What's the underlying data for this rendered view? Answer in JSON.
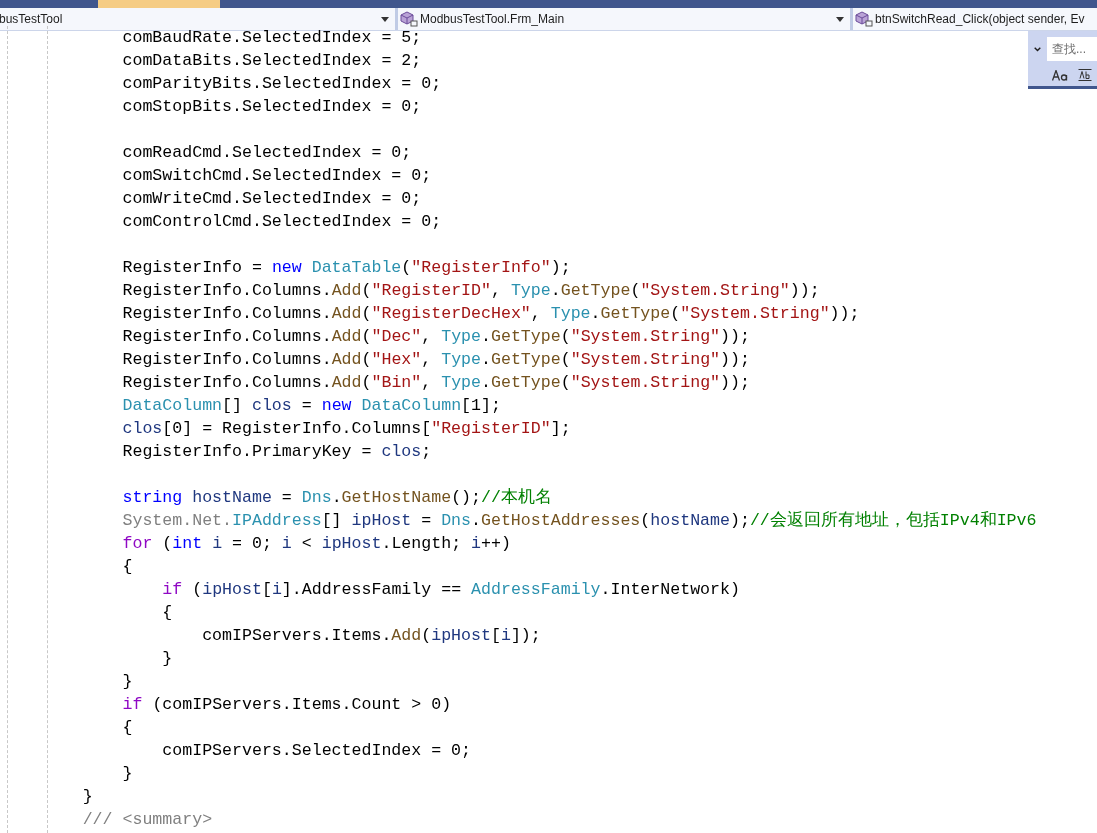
{
  "nav_bar": {
    "project": "busTestTool",
    "class": "ModbusTestTool.Frm_Main",
    "member": "btnSwitchRead_Click(object sender, Ev"
  },
  "find_widget": {
    "placeholder": "查找..."
  },
  "code_lines": [
    {
      "kind": "code",
      "tokens": [
        {
          "kind": "plain",
          "text": "            comBaudRate.SelectedIndex = 5;"
        }
      ]
    },
    {
      "kind": "code",
      "tokens": [
        {
          "kind": "plain",
          "text": "            comDataBits.SelectedIndex = 2;"
        }
      ]
    },
    {
      "kind": "code",
      "tokens": [
        {
          "kind": "plain",
          "text": "            comParityBits.SelectedIndex = 0;"
        }
      ]
    },
    {
      "kind": "code",
      "tokens": [
        {
          "kind": "plain",
          "text": "            comStopBits.SelectedIndex = 0;"
        }
      ]
    },
    {
      "kind": "blank"
    },
    {
      "kind": "code",
      "tokens": [
        {
          "kind": "plain",
          "text": "            comReadCmd.SelectedIndex = 0;"
        }
      ]
    },
    {
      "kind": "code",
      "tokens": [
        {
          "kind": "plain",
          "text": "            comSwitchCmd.SelectedIndex = 0;"
        }
      ]
    },
    {
      "kind": "code",
      "tokens": [
        {
          "kind": "plain",
          "text": "            comWriteCmd.SelectedIndex = 0;"
        }
      ]
    },
    {
      "kind": "code",
      "tokens": [
        {
          "kind": "plain",
          "text": "            comControlCmd.SelectedIndex = 0;"
        }
      ]
    },
    {
      "kind": "blank"
    },
    {
      "kind": "code",
      "tokens": [
        {
          "kind": "plain",
          "text": "            RegisterInfo = "
        },
        {
          "kind": "keyword",
          "text": "new"
        },
        {
          "kind": "type",
          "text": " DataTable"
        },
        {
          "kind": "plain",
          "text": "("
        },
        {
          "kind": "string",
          "text": "\"RegisterInfo\""
        },
        {
          "kind": "plain",
          "text": ");"
        }
      ]
    },
    {
      "kind": "code",
      "tokens": [
        {
          "kind": "plain",
          "text": "            RegisterInfo.Columns."
        },
        {
          "kind": "method",
          "text": "Add"
        },
        {
          "kind": "plain",
          "text": "("
        },
        {
          "kind": "string",
          "text": "\"RegisterID\""
        },
        {
          "kind": "plain",
          "text": ", "
        },
        {
          "kind": "type",
          "text": "Type"
        },
        {
          "kind": "plain",
          "text": "."
        },
        {
          "kind": "method",
          "text": "GetType"
        },
        {
          "kind": "plain",
          "text": "("
        },
        {
          "kind": "string",
          "text": "\"System.String\""
        },
        {
          "kind": "plain",
          "text": "));"
        }
      ]
    },
    {
      "kind": "code",
      "tokens": [
        {
          "kind": "plain",
          "text": "            RegisterInfo.Columns."
        },
        {
          "kind": "method",
          "text": "Add"
        },
        {
          "kind": "plain",
          "text": "("
        },
        {
          "kind": "string",
          "text": "\"RegisterDecHex\""
        },
        {
          "kind": "plain",
          "text": ", "
        },
        {
          "kind": "type",
          "text": "Type"
        },
        {
          "kind": "plain",
          "text": "."
        },
        {
          "kind": "method",
          "text": "GetType"
        },
        {
          "kind": "plain",
          "text": "("
        },
        {
          "kind": "string",
          "text": "\"System.String\""
        },
        {
          "kind": "plain",
          "text": "));"
        }
      ]
    },
    {
      "kind": "code",
      "tokens": [
        {
          "kind": "plain",
          "text": "            RegisterInfo.Columns."
        },
        {
          "kind": "method",
          "text": "Add"
        },
        {
          "kind": "plain",
          "text": "("
        },
        {
          "kind": "string",
          "text": "\"Dec\""
        },
        {
          "kind": "plain",
          "text": ", "
        },
        {
          "kind": "type",
          "text": "Type"
        },
        {
          "kind": "plain",
          "text": "."
        },
        {
          "kind": "method",
          "text": "GetType"
        },
        {
          "kind": "plain",
          "text": "("
        },
        {
          "kind": "string",
          "text": "\"System.String\""
        },
        {
          "kind": "plain",
          "text": "));"
        }
      ]
    },
    {
      "kind": "code",
      "tokens": [
        {
          "kind": "plain",
          "text": "            RegisterInfo.Columns."
        },
        {
          "kind": "method",
          "text": "Add"
        },
        {
          "kind": "plain",
          "text": "("
        },
        {
          "kind": "string",
          "text": "\"Hex\""
        },
        {
          "kind": "plain",
          "text": ", "
        },
        {
          "kind": "type",
          "text": "Type"
        },
        {
          "kind": "plain",
          "text": "."
        },
        {
          "kind": "method",
          "text": "GetType"
        },
        {
          "kind": "plain",
          "text": "("
        },
        {
          "kind": "string",
          "text": "\"System.String\""
        },
        {
          "kind": "plain",
          "text": "));"
        }
      ]
    },
    {
      "kind": "code",
      "tokens": [
        {
          "kind": "plain",
          "text": "            RegisterInfo.Columns."
        },
        {
          "kind": "method",
          "text": "Add"
        },
        {
          "kind": "plain",
          "text": "("
        },
        {
          "kind": "string",
          "text": "\"Bin\""
        },
        {
          "kind": "plain",
          "text": ", "
        },
        {
          "kind": "type",
          "text": "Type"
        },
        {
          "kind": "plain",
          "text": "."
        },
        {
          "kind": "method",
          "text": "GetType"
        },
        {
          "kind": "plain",
          "text": "("
        },
        {
          "kind": "string",
          "text": "\"System.String\""
        },
        {
          "kind": "plain",
          "text": "));"
        }
      ]
    },
    {
      "kind": "code",
      "tokens": [
        {
          "kind": "type",
          "text": "            DataColumn"
        },
        {
          "kind": "plain",
          "text": "[] "
        },
        {
          "kind": "local",
          "text": "clos"
        },
        {
          "kind": "plain",
          "text": " = "
        },
        {
          "kind": "keyword",
          "text": "new"
        },
        {
          "kind": "type",
          "text": " DataColumn"
        },
        {
          "kind": "plain",
          "text": "[1];"
        }
      ]
    },
    {
      "kind": "code",
      "tokens": [
        {
          "kind": "local",
          "text": "            clos"
        },
        {
          "kind": "plain",
          "text": "[0] = RegisterInfo.Columns["
        },
        {
          "kind": "string",
          "text": "\"RegisterID\""
        },
        {
          "kind": "plain",
          "text": "];"
        }
      ]
    },
    {
      "kind": "code",
      "tokens": [
        {
          "kind": "plain",
          "text": "            RegisterInfo.PrimaryKey = "
        },
        {
          "kind": "local",
          "text": "clos"
        },
        {
          "kind": "plain",
          "text": ";"
        }
      ]
    },
    {
      "kind": "blank"
    },
    {
      "kind": "code",
      "tokens": [
        {
          "kind": "keyword",
          "text": "            string"
        },
        {
          "kind": "local",
          "text": " hostName"
        },
        {
          "kind": "plain",
          "text": " = "
        },
        {
          "kind": "type",
          "text": "Dns"
        },
        {
          "kind": "plain",
          "text": "."
        },
        {
          "kind": "method",
          "text": "GetHostName"
        },
        {
          "kind": "plain",
          "text": "();"
        },
        {
          "kind": "comment",
          "text": "//本机名"
        }
      ]
    },
    {
      "kind": "code",
      "tokens": [
        {
          "kind": "dim",
          "text": "            System.Net."
        },
        {
          "kind": "type",
          "text": "IPAddress"
        },
        {
          "kind": "plain",
          "text": "[] "
        },
        {
          "kind": "local",
          "text": "ipHost"
        },
        {
          "kind": "plain",
          "text": " = "
        },
        {
          "kind": "type",
          "text": "Dns"
        },
        {
          "kind": "plain",
          "text": "."
        },
        {
          "kind": "method",
          "text": "GetHostAddresses"
        },
        {
          "kind": "plain",
          "text": "("
        },
        {
          "kind": "local",
          "text": "hostName"
        },
        {
          "kind": "plain",
          "text": ");"
        },
        {
          "kind": "comment",
          "text": "//会返回所有地址，包括IPv4和IPv6"
        }
      ]
    },
    {
      "kind": "code",
      "tokens": [
        {
          "kind": "control",
          "text": "            for"
        },
        {
          "kind": "plain",
          "text": " ("
        },
        {
          "kind": "keyword",
          "text": "int"
        },
        {
          "kind": "local",
          "text": " i"
        },
        {
          "kind": "plain",
          "text": " = 0; "
        },
        {
          "kind": "local",
          "text": "i"
        },
        {
          "kind": "plain",
          "text": " < "
        },
        {
          "kind": "local",
          "text": "ipHost"
        },
        {
          "kind": "plain",
          "text": ".Length; "
        },
        {
          "kind": "local",
          "text": "i"
        },
        {
          "kind": "plain",
          "text": "++)"
        }
      ]
    },
    {
      "kind": "code",
      "tokens": [
        {
          "kind": "plain",
          "text": "            {"
        }
      ]
    },
    {
      "kind": "code",
      "tokens": [
        {
          "kind": "control",
          "text": "                if"
        },
        {
          "kind": "plain",
          "text": " ("
        },
        {
          "kind": "local",
          "text": "ipHost"
        },
        {
          "kind": "plain",
          "text": "["
        },
        {
          "kind": "local",
          "text": "i"
        },
        {
          "kind": "plain",
          "text": "].AddressFamily == "
        },
        {
          "kind": "type",
          "text": "AddressFamily"
        },
        {
          "kind": "plain",
          "text": ".InterNetwork)"
        }
      ]
    },
    {
      "kind": "code",
      "tokens": [
        {
          "kind": "plain",
          "text": "                {"
        }
      ]
    },
    {
      "kind": "code",
      "tokens": [
        {
          "kind": "plain",
          "text": "                    comIPServers.Items."
        },
        {
          "kind": "method",
          "text": "Add"
        },
        {
          "kind": "plain",
          "text": "("
        },
        {
          "kind": "local",
          "text": "ipHost"
        },
        {
          "kind": "plain",
          "text": "["
        },
        {
          "kind": "local",
          "text": "i"
        },
        {
          "kind": "plain",
          "text": "]);"
        }
      ]
    },
    {
      "kind": "code",
      "tokens": [
        {
          "kind": "plain",
          "text": "                }"
        }
      ]
    },
    {
      "kind": "code",
      "tokens": [
        {
          "kind": "plain",
          "text": "            }"
        }
      ]
    },
    {
      "kind": "code",
      "tokens": [
        {
          "kind": "control",
          "text": "            if"
        },
        {
          "kind": "plain",
          "text": " (comIPServers.Items.Count > 0)"
        }
      ]
    },
    {
      "kind": "code",
      "tokens": [
        {
          "kind": "plain",
          "text": "            {"
        }
      ]
    },
    {
      "kind": "code",
      "tokens": [
        {
          "kind": "plain",
          "text": "                comIPServers.SelectedIndex = 0;"
        }
      ]
    },
    {
      "kind": "code",
      "tokens": [
        {
          "kind": "plain",
          "text": "            }"
        }
      ]
    },
    {
      "kind": "code",
      "tokens": [
        {
          "kind": "plain",
          "text": "        }"
        }
      ]
    },
    {
      "kind": "code",
      "tokens": [
        {
          "kind": "dim",
          "text": "        /// <summary>"
        }
      ]
    }
  ]
}
